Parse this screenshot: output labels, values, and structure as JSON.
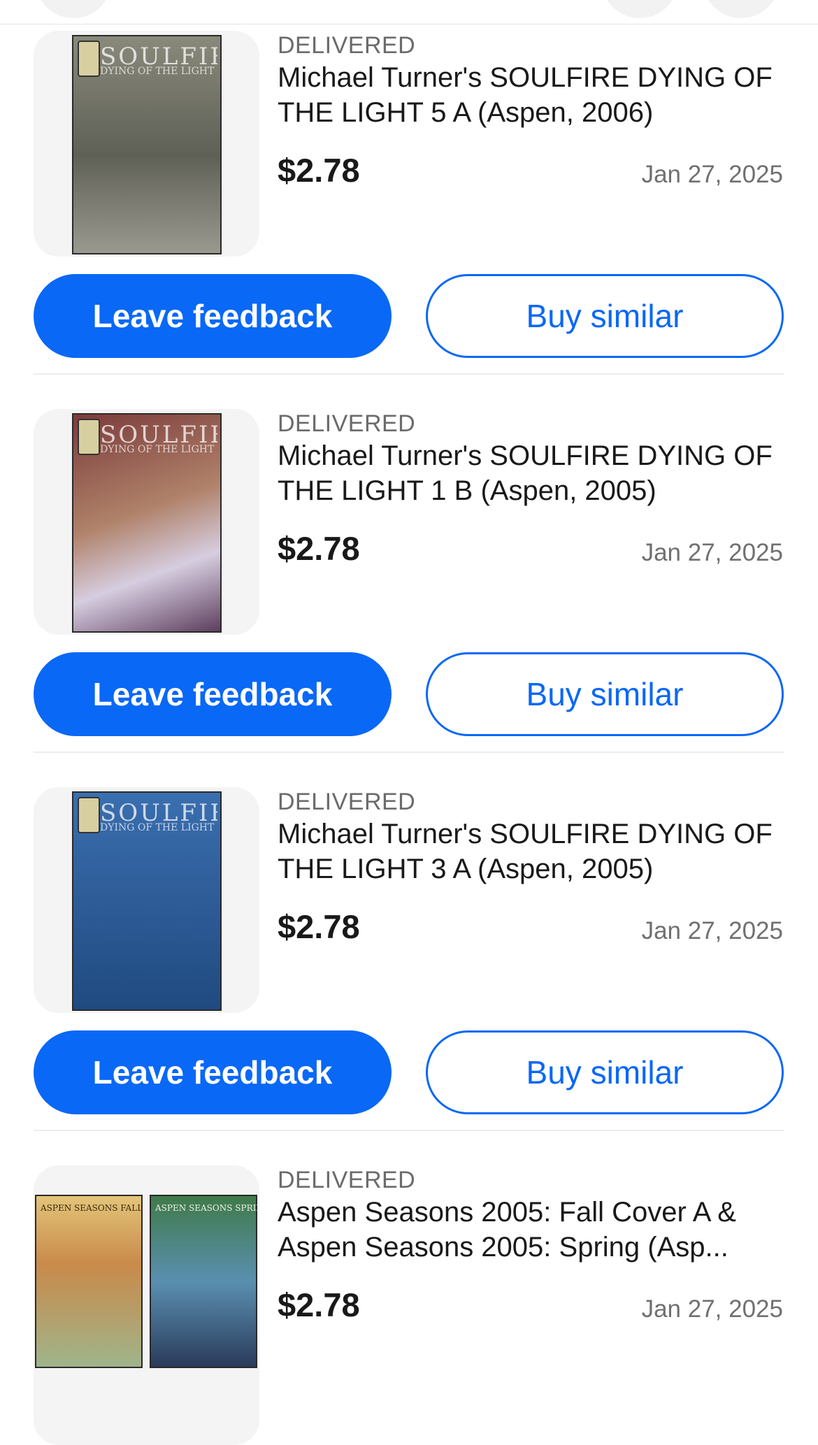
{
  "orders": [
    {
      "status": "DELIVERED",
      "title": "Michael Turner's SOULFIRE DYING OF THE LIGHT 5 A (Aspen, 2006)",
      "price": "$2.78",
      "date": "Jan 27, 2025",
      "cover_text": "SOULFIRE",
      "cover_sub": "DYING OF THE LIGHT",
      "cover_color": "#6f6f66",
      "primary_label": "Leave feedback",
      "secondary_label": "Buy similar"
    },
    {
      "status": "DELIVERED",
      "title": "Michael Turner's SOULFIRE DYING OF THE LIGHT 1 B (Aspen, 2005)",
      "price": "$2.78",
      "date": "Jan 27, 2025",
      "cover_text": "SOULFIRE",
      "cover_sub": "DYING OF THE LIGHT",
      "cover_color": "#7a3a3a",
      "primary_label": "Leave feedback",
      "secondary_label": "Buy similar"
    },
    {
      "status": "DELIVERED",
      "title": "Michael Turner's SOULFIRE DYING OF THE LIGHT 3 A (Aspen, 2005)",
      "price": "$2.78",
      "date": "Jan 27, 2025",
      "cover_text": "SOULFIRE",
      "cover_sub": "DYING OF THE LIGHT",
      "cover_color": "#2e5c97",
      "primary_label": "Leave feedback",
      "secondary_label": "Buy similar"
    },
    {
      "status": "DELIVERED",
      "title": "Aspen Seasons 2005: Fall Cover A & Aspen Seasons 2005: Spring (Asp...",
      "price": "$2.78",
      "date": "Jan 27, 2025",
      "covers": [
        {
          "text": "ASPEN SEASONS FALL",
          "color": "#c98a4a"
        },
        {
          "text": "ASPEN SEASONS SPRING",
          "color": "#3f7a48"
        }
      ]
    }
  ],
  "colors": {
    "accent": "#0968f6",
    "text": "#191919",
    "muted": "#707070"
  }
}
